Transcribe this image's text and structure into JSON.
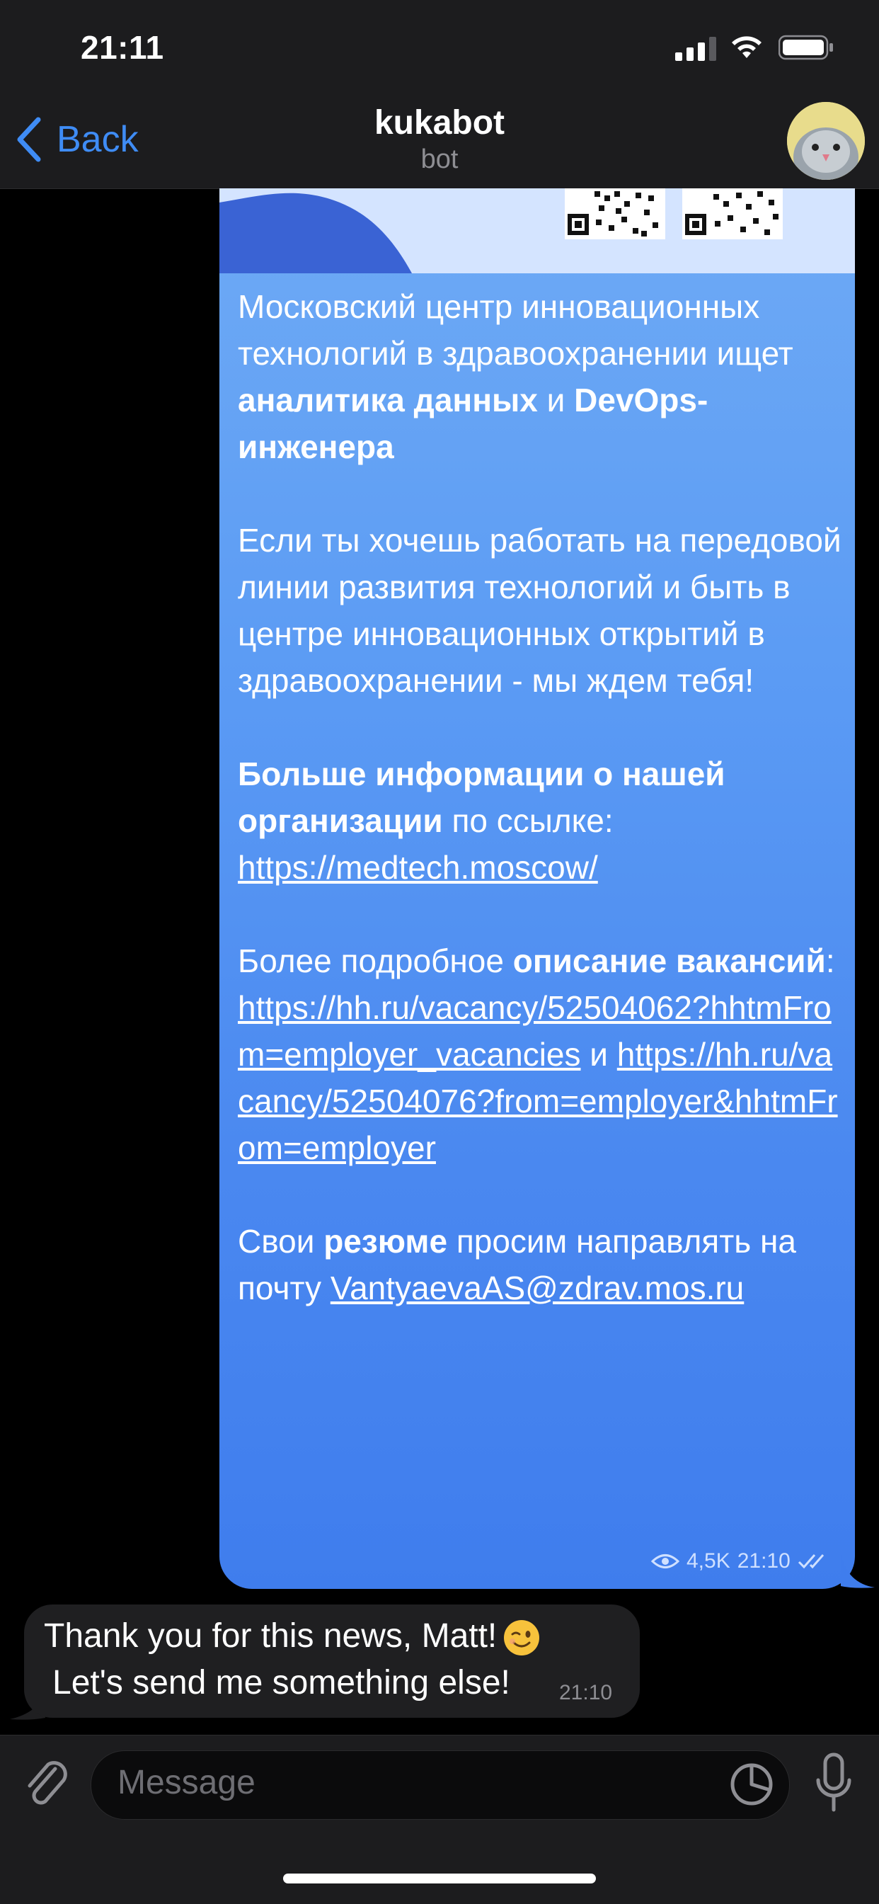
{
  "status_bar": {
    "time": "21:11"
  },
  "nav": {
    "back_label": "Back",
    "title": "kukabot",
    "subtitle": "bot"
  },
  "post": {
    "p1_a": "Московский центр инновационных технологий в здравоохранении ищет ",
    "p1_b": "аналитика данных",
    "p1_c": " и ",
    "p1_d": "DevOps-инженера",
    "p2": "Если ты хочешь работать на передовой линии развития технологий и быть в центре инновационных открытий в здравоохранении - мы ждем тебя!",
    "p3_a": "Больше информации о нашей организации",
    "p3_b": " по ссылке: ",
    "p3_link": "https://medtech.moscow/",
    "p4_a": "Более подробное ",
    "p4_b": "описание вакансий",
    "p4_c": ": ",
    "p4_link1": "https://hh.ru/vacancy/52504062?hhtmFrom=employer_vacancies",
    "p4_d": " и ",
    "p4_link2": "https://hh.ru/vacancy/52504076?from=employer&hhtmFrom=employer",
    "p5_a": "Свои ",
    "p5_b": "резюме",
    "p5_c": " просим направлять на почту ",
    "p5_email": "VantyaevaAS@zdrav.mos.ru",
    "views": "4,5K",
    "time": "21:10"
  },
  "reply": {
    "line1": "Thank you for this news, Matt!",
    "line2": "Let's send me something else!",
    "time": "21:10"
  },
  "input": {
    "placeholder": "Message"
  },
  "colors": {
    "accent": "#3f8cf5",
    "bubble_top": "#6eaaf5",
    "bubble_bottom": "#3f7ded",
    "incoming": "#1f1f21"
  }
}
